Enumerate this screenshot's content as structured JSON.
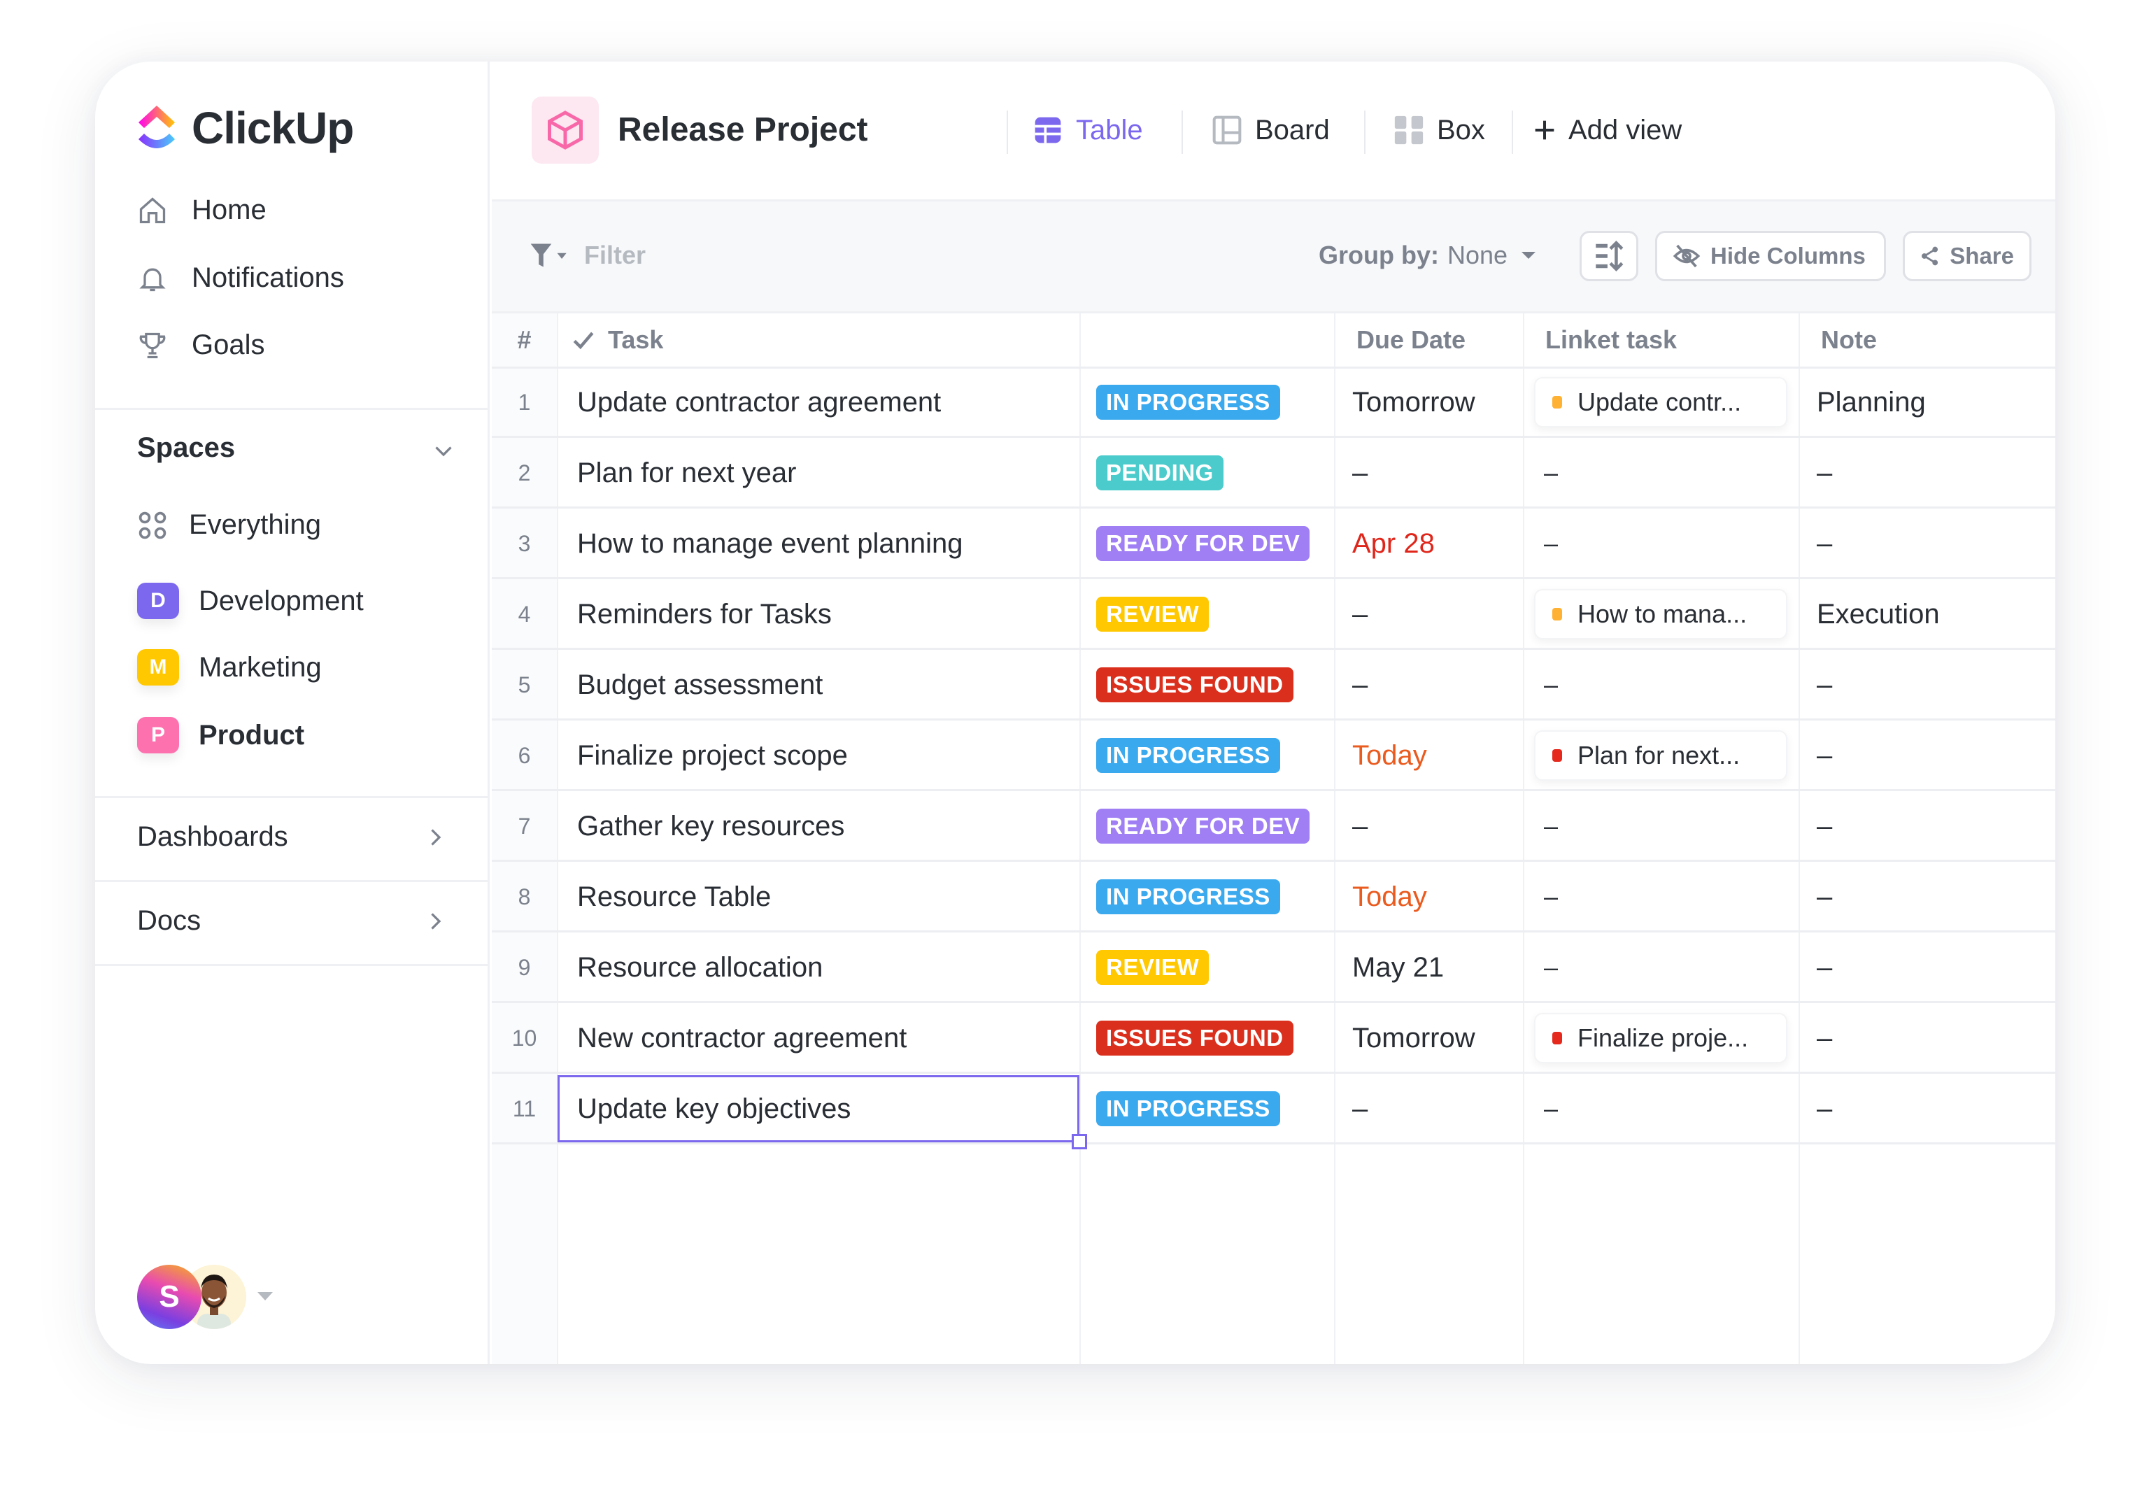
{
  "sidebar": {
    "brand": "ClickUp",
    "nav": [
      {
        "label": "Home",
        "icon": "home-icon"
      },
      {
        "label": "Notifications",
        "icon": "bell-icon"
      },
      {
        "label": "Goals",
        "icon": "trophy-icon"
      }
    ],
    "spaces_title": "Spaces",
    "everything_label": "Everything",
    "spaces": [
      {
        "letter": "D",
        "label": "Development",
        "color": "#7b68ee",
        "active": false
      },
      {
        "letter": "M",
        "label": "Marketing",
        "color": "#ffc800",
        "active": false
      },
      {
        "letter": "P",
        "label": "Product",
        "color": "#fd71af",
        "active": true
      }
    ],
    "dashboards_label": "Dashboards",
    "docs_label": "Docs",
    "user_initial": "S"
  },
  "header": {
    "project_title": "Release Project",
    "views": [
      {
        "label": "Table",
        "icon": "table-icon",
        "active": true
      },
      {
        "label": "Board",
        "icon": "board-icon",
        "active": false
      },
      {
        "label": "Box",
        "icon": "box-icon",
        "active": false
      }
    ],
    "add_view_label": "Add view",
    "accent": "#7b68ee"
  },
  "toolbar": {
    "filter_label": "Filter",
    "group_by_label": "Group by:",
    "group_by_value": "None",
    "hide_columns_label": "Hide Columns",
    "share_label": "Share"
  },
  "table": {
    "columns": {
      "num": "#",
      "task": "Task",
      "status": "",
      "due": "Due Date",
      "linked": "Linket task",
      "note": "Note"
    },
    "status_colors": {
      "IN PROGRESS": "#3aa9ee",
      "PENDING": "#4bcbcb",
      "READY FOR DEV": "#a07ff4",
      "REVIEW": "#ffc800",
      "ISSUES FOUND": "#db2f1d"
    },
    "rows": [
      {
        "num": "1",
        "task": "Update contractor agreement",
        "status": "IN PROGRESS",
        "due": "Tomorrow",
        "due_color": "#292d34",
        "linked": "Update contr...",
        "linked_dot": "#ffb133",
        "note": "Planning"
      },
      {
        "num": "2",
        "task": "Plan for next year",
        "status": "PENDING",
        "due": "–",
        "due_color": "#292d34",
        "linked": "–",
        "linked_dot": "",
        "note": "–"
      },
      {
        "num": "3",
        "task": "How to manage event planning",
        "status": "READY FOR DEV",
        "due": "Apr 28",
        "due_color": "#e0261b",
        "linked": "–",
        "linked_dot": "",
        "note": "–"
      },
      {
        "num": "4",
        "task": "Reminders for Tasks",
        "status": "REVIEW",
        "due": "–",
        "due_color": "#292d34",
        "linked": "How to mana...",
        "linked_dot": "#ffb133",
        "note": "Execution"
      },
      {
        "num": "5",
        "task": "Budget assessment",
        "status": "ISSUES FOUND",
        "due": "–",
        "due_color": "#292d34",
        "linked": "–",
        "linked_dot": "",
        "note": "–"
      },
      {
        "num": "6",
        "task": "Finalize project scope",
        "status": "IN PROGRESS",
        "due": "Today",
        "due_color": "#ea5b1f",
        "linked": "Plan for next...",
        "linked_dot": "#e5291d",
        "note": "–"
      },
      {
        "num": "7",
        "task": "Gather key resources",
        "status": "READY FOR DEV",
        "due": "–",
        "due_color": "#292d34",
        "linked": "–",
        "linked_dot": "",
        "note": "–"
      },
      {
        "num": "8",
        "task": "Resource Table",
        "status": "IN PROGRESS",
        "due": "Today",
        "due_color": "#ea5b1f",
        "linked": "–",
        "linked_dot": "",
        "note": "–"
      },
      {
        "num": "9",
        "task": "Resource allocation",
        "status": "REVIEW",
        "due": "May 21",
        "due_color": "#292d34",
        "linked": "–",
        "linked_dot": "",
        "note": "–"
      },
      {
        "num": "10",
        "task": "New contractor agreement",
        "status": "ISSUES FOUND",
        "due": "Tomorrow",
        "due_color": "#292d34",
        "linked": "Finalize proje...",
        "linked_dot": "#e5291d",
        "note": "–"
      },
      {
        "num": "11",
        "task": "Update key objectives",
        "status": "IN PROGRESS",
        "due": "–",
        "due_color": "#292d34",
        "linked": "–",
        "linked_dot": "",
        "note": "–",
        "selected": true
      }
    ]
  }
}
